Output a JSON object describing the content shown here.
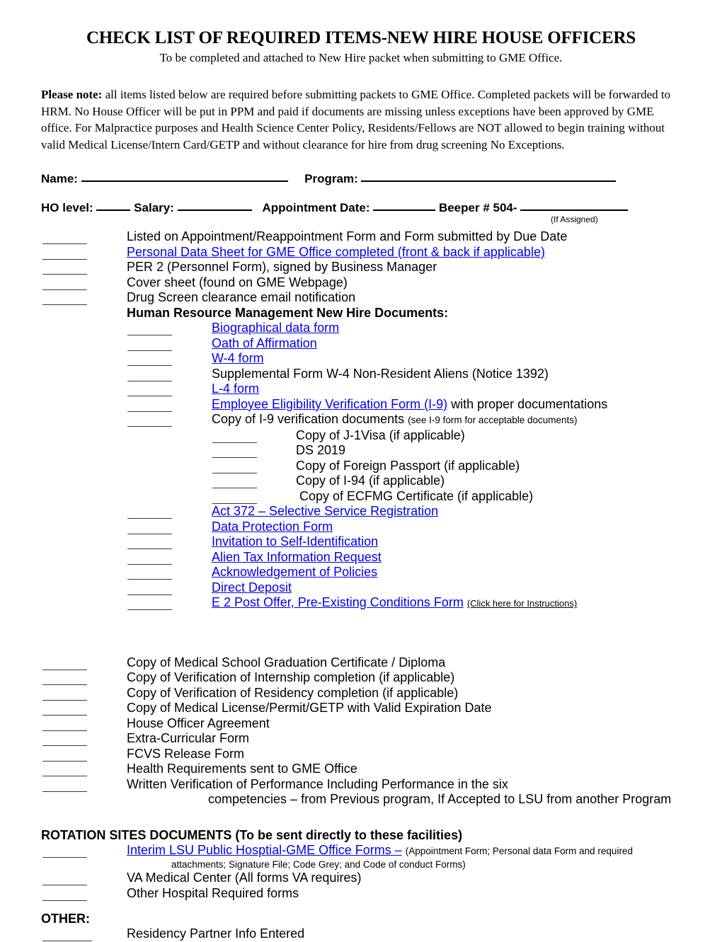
{
  "document": {
    "title": "CHECK LIST OF REQUIRED ITEMS-NEW HIRE HOUSE OFFICERS",
    "subtitle": "To be completed and attached to New Hire packet when submitting to GME Office.",
    "note_label": "Please note:",
    "note_body": " all items listed below are required before submitting packets to GME Office. Completed packets will be forwarded to HRM. No House Officer will be put in PPM and paid if documents are missing unless exceptions have been approved by GME office.  For Malpractice purposes and Health Science Center Policy, Residents/Fellows are NOT allowed to begin training without valid Medical License/Intern Card/GETP and without clearance for hire from drug screening No Exceptions."
  },
  "fields": {
    "name_label": "Name:",
    "program_label": "Program:",
    "ho_level_label": "HO level:",
    "salary_label": "Salary:",
    "appointment_date_label": "Appointment Date:",
    "beeper_label": "Beeper # 504-",
    "if_assigned_note": "(If Assigned)"
  },
  "checklist": {
    "level1_first": [
      {
        "text": "Listed on Appointment/Reappointment Form and Form submitted by Due Date",
        "link": false
      },
      {
        "text": "Personal Data Sheet for GME Office completed (front & back if applicable)",
        "link": true
      },
      {
        "text": "PER 2 (Personnel Form), signed by Business Manager",
        "link": false
      },
      {
        "text": "Cover sheet (found on GME Webpage)",
        "link": false
      },
      {
        "text": "Drug Screen clearance email notification",
        "link": false
      }
    ],
    "hrm_heading": "Human Resource Management New Hire Documents:",
    "hrm_items": [
      {
        "text": "Biographical data form",
        "link": true
      },
      {
        "text": "Oath of Affirmation",
        "link": true
      },
      {
        "text": "W-4 form",
        "link": true
      },
      {
        "text": "Supplemental Form W-4 Non-Resident Aliens (Notice 1392)",
        "link": false
      },
      {
        "text": "L-4 form",
        "link": true
      },
      {
        "text": "Employee Eligibility Verification Form (I-9)",
        "link": true,
        "suffix": " with proper documentations"
      },
      {
        "text": "Copy of I-9 verification documents",
        "link": false,
        "small_suffix": "(see I-9 form for acceptable documents)"
      }
    ],
    "visa_items": [
      {
        "text": "Copy of J-1Visa (if applicable)"
      },
      {
        "text": "DS 2019"
      },
      {
        "text": "Copy of Foreign Passport (if applicable)"
      },
      {
        "text": "Copy of I-94 (if applicable)"
      },
      {
        "text": "Copy of ECFMG Certificate (if applicable)"
      }
    ],
    "hrm_forms": [
      {
        "text": "Act 372 – Selective Service Registration",
        "link": true
      },
      {
        "text": "Data Protection Form",
        "link": true
      },
      {
        "text": "Invitation to Self-Identification",
        "link": true
      },
      {
        "text": "Alien Tax Information Request",
        "link": true
      },
      {
        "text": "Acknowledgement of Policies",
        "link": true
      },
      {
        "text": "Direct Deposit",
        "link": true
      },
      {
        "text": "E 2 Post Offer, Pre-Existing Conditions Form",
        "link": true,
        "small_link_suffix": "(Click here for Instructions)"
      }
    ],
    "credential_items": [
      {
        "text": "Copy of Medical School Graduation Certificate / Diploma"
      },
      {
        "text": "Copy of Verification of Internship completion (if applicable)"
      },
      {
        "text": "Copy of Verification of Residency completion (if applicable)"
      },
      {
        "text": "Copy of Medical License/Permit/GETP with Valid Expiration Date"
      },
      {
        "text": "House Officer Agreement"
      },
      {
        "text": "Extra-Curricular Form"
      },
      {
        "text": "FCVS Release Form"
      },
      {
        "text": "Health Requirements sent to GME Office"
      },
      {
        "text": "Written Verification of Performance Including Performance in the six"
      }
    ],
    "competencies_continuation": "competencies – from Previous program, If Accepted to LSU from another Program"
  },
  "rotation": {
    "heading": "ROTATION SITES DOCUMENTS (To be sent directly to these facilities)",
    "interim_link": "Interim LSU Public Hosptial-GME Office  Forms –",
    "interim_paren": "(Appointment Form; Personal data Form and required",
    "interim_paren_2": "attachments; Signature File; Code Grey; and Code of conduct Forms)",
    "items": [
      {
        "text": "VA Medical Center (All forms VA requires)"
      },
      {
        "text": "Other Hospital Required forms"
      }
    ]
  },
  "other": {
    "heading": "OTHER:",
    "items": [
      {
        "text": "Residency Partner Info Entered"
      }
    ]
  },
  "colors": {
    "link": "#0000EE",
    "text": "#000000",
    "rule": "#3a3a3a"
  }
}
